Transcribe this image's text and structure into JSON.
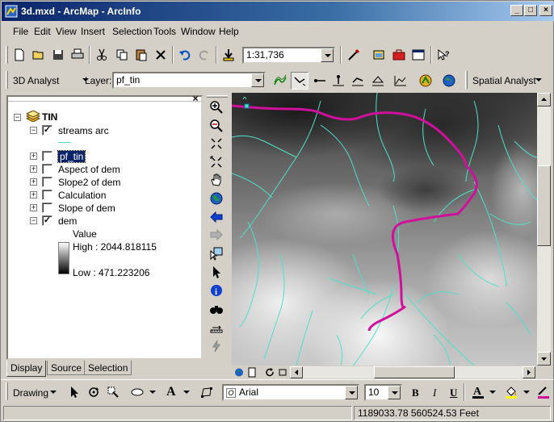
{
  "window": {
    "title": "3d.mxd - ArcMap - ArcInfo",
    "controls": {
      "minimize": "_",
      "maximize": "□",
      "close": "×"
    }
  },
  "menu": [
    "File",
    "Edit",
    "View",
    "Insert",
    "Selection",
    "Tools",
    "Window",
    "Help"
  ],
  "standard_toolbar": {
    "scale_value": "1:31,736",
    "buttons": [
      "new-document-icon",
      "open-icon",
      "save-icon",
      "print-icon",
      "cut-icon",
      "copy-icon",
      "paste-icon",
      "delete-icon",
      "undo-icon",
      "redo-icon",
      "add-data-icon",
      "editor-icon",
      "arctoolbox-icon",
      "arccatalog-icon",
      "command-line-icon",
      "whats-this-icon"
    ]
  },
  "analyst_toolbar": {
    "name": "3D Analyst",
    "layer_label": "Layer:",
    "layer_value": "pf_tin",
    "spatial_analyst": "Spatial Analyst"
  },
  "toc": {
    "root": "TIN",
    "layers": [
      {
        "name": "streams arc",
        "checked": true,
        "expanded": true
      },
      {
        "name": "pf_tin",
        "checked": false,
        "expanded": false,
        "selected": true
      },
      {
        "name": "Aspect of dem",
        "checked": false,
        "expanded": false
      },
      {
        "name": "Slope2 of dem",
        "checked": false,
        "expanded": false
      },
      {
        "name": "Calculation",
        "checked": false,
        "expanded": false
      },
      {
        "name": "Slope of dem",
        "checked": false,
        "expanded": false
      },
      {
        "name": "dem",
        "checked": true,
        "expanded": true
      }
    ],
    "legend": {
      "title": "Value",
      "high": "High : 2044.818115",
      "low": "Low : 471.223206"
    },
    "check_mark": "✓",
    "expand_plus": "+",
    "expand_minus": "−"
  },
  "tabs": [
    "Display",
    "Source",
    "Selection"
  ],
  "drawing_toolbar": {
    "drawing_label": "Drawing",
    "font": "Arial",
    "font_size": "10",
    "bold": "B",
    "italic": "I",
    "underline": "U",
    "text_tool": "A"
  },
  "status": {
    "coordinates": "1189033.78  560524.53 Feet"
  },
  "colors": {
    "stream": "#4fe0c8",
    "highlight_path": "#d0109c",
    "title_start": "#0a246a"
  }
}
